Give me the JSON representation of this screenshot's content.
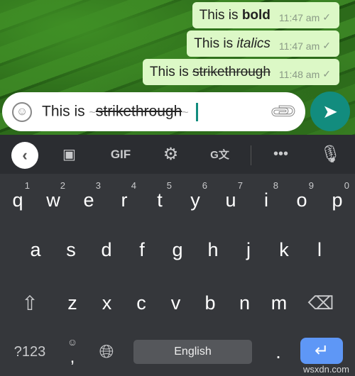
{
  "messages": [
    {
      "prefix": "This is ",
      "styled": "bold",
      "style": "bold",
      "time": "11:47 am"
    },
    {
      "prefix": "This is ",
      "styled": "italics",
      "style": "italic",
      "time": "11:47 am"
    },
    {
      "prefix": "This is ",
      "styled": "strikethrough",
      "style": "strike",
      "time": "11:48 am"
    }
  ],
  "composer": {
    "prefix": "This is ",
    "tilde_open": "~",
    "styled": "strikethrough",
    "tilde_close": "~"
  },
  "toolbar": {
    "gif": "GIF"
  },
  "keys": {
    "row1": [
      [
        "q",
        "1"
      ],
      [
        "w",
        "2"
      ],
      [
        "e",
        "3"
      ],
      [
        "r",
        "4"
      ],
      [
        "t",
        "5"
      ],
      [
        "y",
        "6"
      ],
      [
        "u",
        "7"
      ],
      [
        "i",
        "8"
      ],
      [
        "o",
        "9"
      ],
      [
        "p",
        "0"
      ]
    ],
    "row2": [
      "a",
      "s",
      "d",
      "f",
      "g",
      "h",
      "j",
      "k",
      "l"
    ],
    "row3": [
      "z",
      "x",
      "c",
      "v",
      "b",
      "n",
      "m"
    ],
    "symbols": "?123",
    "comma": ",",
    "period": ".",
    "space": "English"
  },
  "colors": {
    "bubble": "#dcf8c6",
    "accent": "#128c7e",
    "enter": "#5e97f6"
  },
  "watermark": "wsxdn.com"
}
